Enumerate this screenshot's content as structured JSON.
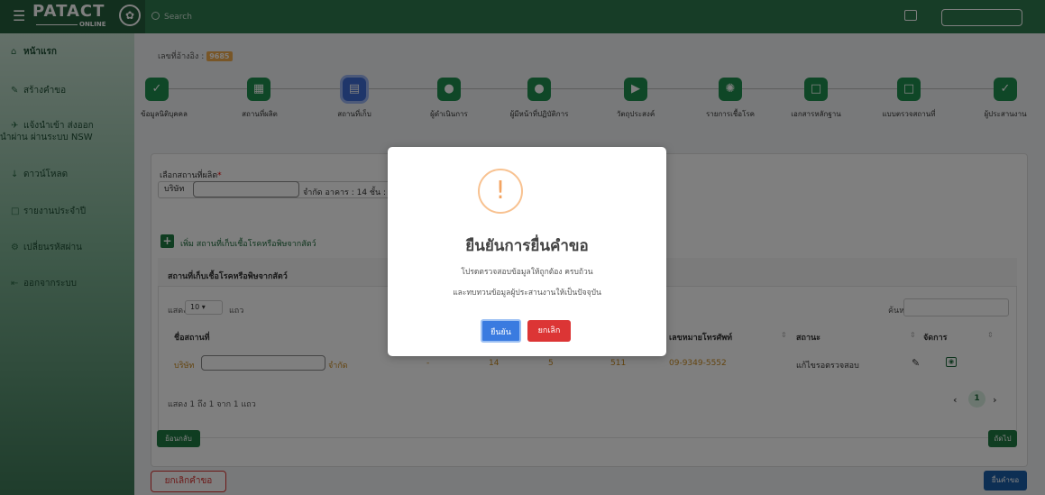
{
  "header": {
    "logo_text": "PATACT",
    "logo_sub": "ONLINE",
    "search_placeholder": "Search"
  },
  "sidebar": {
    "items": [
      {
        "label": "หน้าแรก",
        "icon": "home-icon"
      },
      {
        "label": "สร้างคำขอ",
        "icon": "pen-icon"
      },
      {
        "label": "แจ้งนำเข้า ส่งออก",
        "label2": "นำผ่าน ผ่านระบบ NSW",
        "icon": "plane-icon"
      },
      {
        "label": "ดาวน์โหลด",
        "icon": "download-icon"
      },
      {
        "label": "รายงานประจำปี",
        "icon": "file-icon"
      },
      {
        "label": "เปลี่ยนรหัสผ่าน",
        "icon": "gears-icon"
      },
      {
        "label": "ออกจากระบบ",
        "icon": "logout-icon"
      }
    ]
  },
  "request": {
    "ref_label": "เลขที่อ้างอิง :",
    "ref_no": "9685"
  },
  "steps": [
    {
      "label": "ข้อมูลนิติบุคคล",
      "state": "done"
    },
    {
      "label": "สถานที่ผลิต",
      "state": "done"
    },
    {
      "label": "สถานที่เก็บ",
      "state": "active"
    },
    {
      "label": "ผู้ดำเนินการ",
      "state": "done"
    },
    {
      "label": "ผู้มีหน้าที่ปฏิบัติการ",
      "state": "done"
    },
    {
      "label": "วัตถุประสงค์",
      "state": "done"
    },
    {
      "label": "รายการเชื้อโรค",
      "state": "done"
    },
    {
      "label": "เอกสารหลักฐาน",
      "state": "done"
    },
    {
      "label": "แบบตรวจสถานที่",
      "state": "done"
    },
    {
      "label": "ผู้ประสานงาน",
      "state": "done"
    }
  ],
  "form": {
    "select_label": "เลือกสถานที่ผลิต",
    "req_mark": "*",
    "select_prefix": "บริษัท",
    "select_suffix": "จำกัด อาคาร : 14 ชั้น : 5",
    "add_label": "เพิ่ม สถานที่เก็บเชื้อโรคหรือพิษจากสัตว์"
  },
  "table": {
    "title": "สถานที่เก็บเชื้อโรคหรือพิษจากสัตว์",
    "show_label": "แสดง",
    "page_size": "10",
    "show_unit": "แถว",
    "search_label": "ค้นหา:",
    "columns": [
      "ชื่อสถานที่",
      "เลขหมายโทรศัพท์",
      "สถานะ",
      "จัดการ"
    ],
    "row": {
      "name_prefix": "บริษัท",
      "name_suffix": "จำกัด",
      "dash": "-",
      "building": "14",
      "floor": "5",
      "room": "511",
      "phone": "09-9349-5552",
      "status": "แก้ไขรอตรวจสอบ"
    },
    "info": "แสดง 1 ถึง 1 จาก 1 แถว",
    "page": "1"
  },
  "buttons": {
    "back": "ย้อนกลับ",
    "next": "ถัดไป",
    "cancel_request": "ยกเลิกคำขอ",
    "submit": "ยื่นคำขอ"
  },
  "modal": {
    "icon": "!",
    "title": "ยืนยันการยื่นคำขอ",
    "text1": "โปรดตรวจสอบข้อมูลให้ถูกต้อง ครบถ้วน",
    "text2": "และทบทวนข้อมูลผู้ประสานงานให้เป็นปัจจุบัน",
    "confirm": "ยืนยัน",
    "cancel": "ยกเลิก"
  },
  "colors": {
    "brand_green": "#2f7a4f",
    "active_step": "#3f6cd4",
    "danger": "#dc3535",
    "primary": "#3a7be0"
  }
}
